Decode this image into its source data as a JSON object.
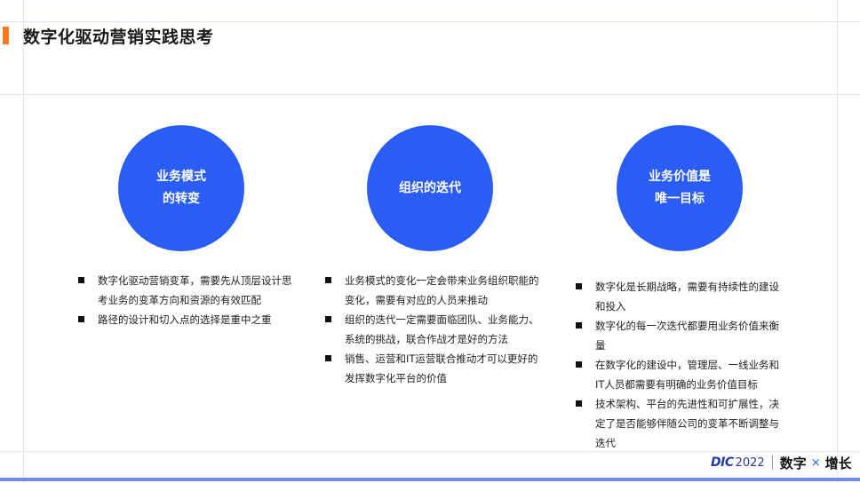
{
  "title": "数字化驱动营销实践思考",
  "colors": {
    "accent": "#ff7a1a",
    "circle": "#2a5df3",
    "brand": "#2a3c9c"
  },
  "columns": [
    {
      "heading_lines": [
        "业务模式",
        "的转变"
      ],
      "bullets": [
        "数字化驱动营销变革，需要先从顶层设计思考业务的变革方向和资源的有效匹配",
        "路径的设计和切入点的选择是重中之重"
      ]
    },
    {
      "heading_lines": [
        "组织的迭代"
      ],
      "bullets": [
        "业务模式的变化一定会带来业务组织职能的变化，需要有对应的人员来推动",
        "组织的迭代一定需要面临团队、业务能力、系统的挑战，联合作战才是好的方法",
        "销售、运营和IT运营联合推动才可以更好的发挥数字化平台的价值"
      ]
    },
    {
      "heading_lines": [
        "业务价值是",
        "唯一目标"
      ],
      "bullets": [
        "数字化是长期战略，需要有持续性的建设和投入",
        "数字化的每一次迭代都要用业务价值来衡量",
        "在数字化的建设中，管理层、一线业务和IT人员都需要有明确的业务价值目标",
        "技术架构、平台的先进性和可扩展性，决定了是否能够伴随公司的变革不断调整与迭代"
      ]
    }
  ],
  "footer": {
    "logo_mark": "DIC",
    "logo_year": "2022",
    "slogan_left": "数字",
    "slogan_x": "×",
    "slogan_right": "增长"
  }
}
